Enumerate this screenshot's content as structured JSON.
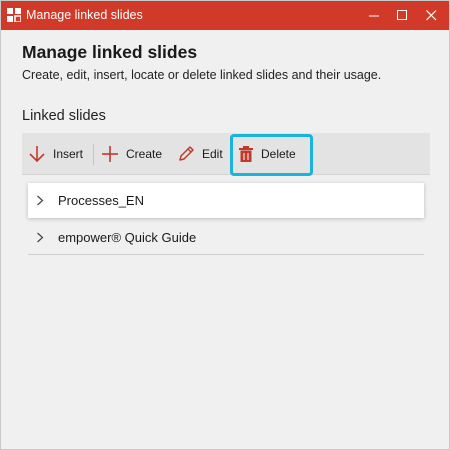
{
  "window": {
    "title": "Manage linked slides",
    "titlebar_color": "#d13a28"
  },
  "main": {
    "heading": "Manage linked slides",
    "subheading": "Create, edit, insert, locate or delete linked slides and their usage.",
    "section_label": "Linked slides"
  },
  "toolbar": {
    "insert_label": "Insert",
    "create_label": "Create",
    "edit_label": "Edit",
    "delete_label": "Delete",
    "icon_color": "#c0392b",
    "highlight_color": "#1ab3de"
  },
  "linked_slides": [
    {
      "label": "Processes_EN",
      "icon": "chevron-right-icon"
    },
    {
      "label": "empower® Quick Guide",
      "icon": "chevron-right-icon"
    }
  ]
}
